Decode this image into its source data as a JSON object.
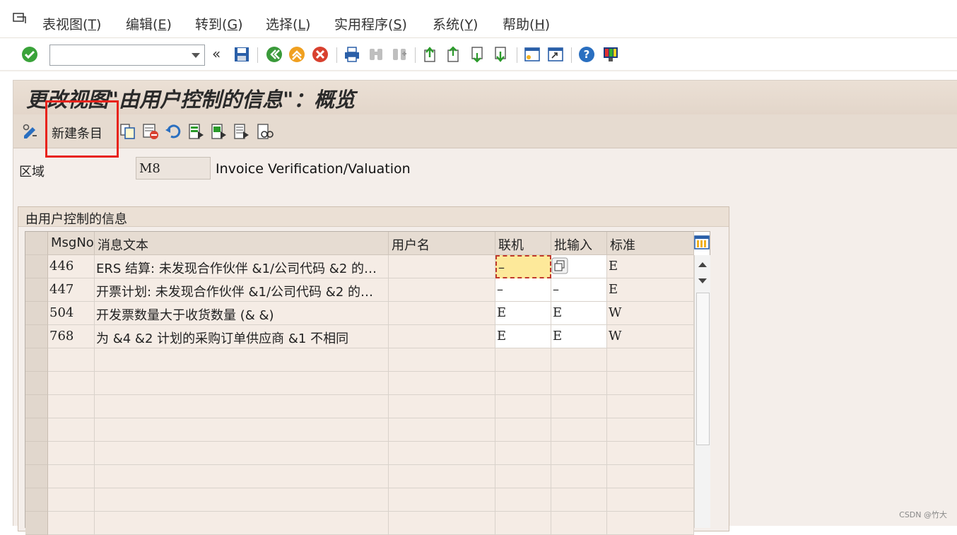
{
  "menubar": {
    "items": [
      {
        "label": "表视图",
        "key": "T"
      },
      {
        "label": "编辑",
        "key": "E"
      },
      {
        "label": "转到",
        "key": "G"
      },
      {
        "label": "选择",
        "key": "L"
      },
      {
        "label": "实用程序",
        "key": "S"
      },
      {
        "label": "系统",
        "key": "Y"
      },
      {
        "label": "帮助",
        "key": "H"
      }
    ]
  },
  "toolbar": {
    "command_field": ""
  },
  "screen": {
    "title": "更改视图\"由用户控制的信息\"：概览",
    "new_entries_label": "新建条目",
    "area_label": "区域",
    "area_value": "M8",
    "area_description": "Invoice Verification/Valuation",
    "group_title": "由用户控制的信息"
  },
  "table": {
    "columns": [
      "MsgNo",
      "消息文本",
      "用户名",
      "联机",
      "批输入",
      "标准"
    ],
    "rows": [
      {
        "msgno": "446",
        "text": "ERS 结算: 未发现合作伙伴 &1/公司代码 &2 的…",
        "user": "",
        "online": "–",
        "batch": "",
        "standard": "E"
      },
      {
        "msgno": "447",
        "text": "开票计划: 未发现合作伙伴 &1/公司代码 &2 的…",
        "user": "",
        "online": "–",
        "batch": "–",
        "standard": "E"
      },
      {
        "msgno": "504",
        "text": "开发票数量大于收货数量 (& &)",
        "user": "",
        "online": "E",
        "batch": "E",
        "standard": "W"
      },
      {
        "msgno": "768",
        "text": "为 &4 &2 计划的采购订单供应商 &1 不相同",
        "user": "",
        "online": "E",
        "batch": "E",
        "standard": "W"
      }
    ]
  },
  "footer": {
    "watermark": "CSDN @竹大"
  }
}
